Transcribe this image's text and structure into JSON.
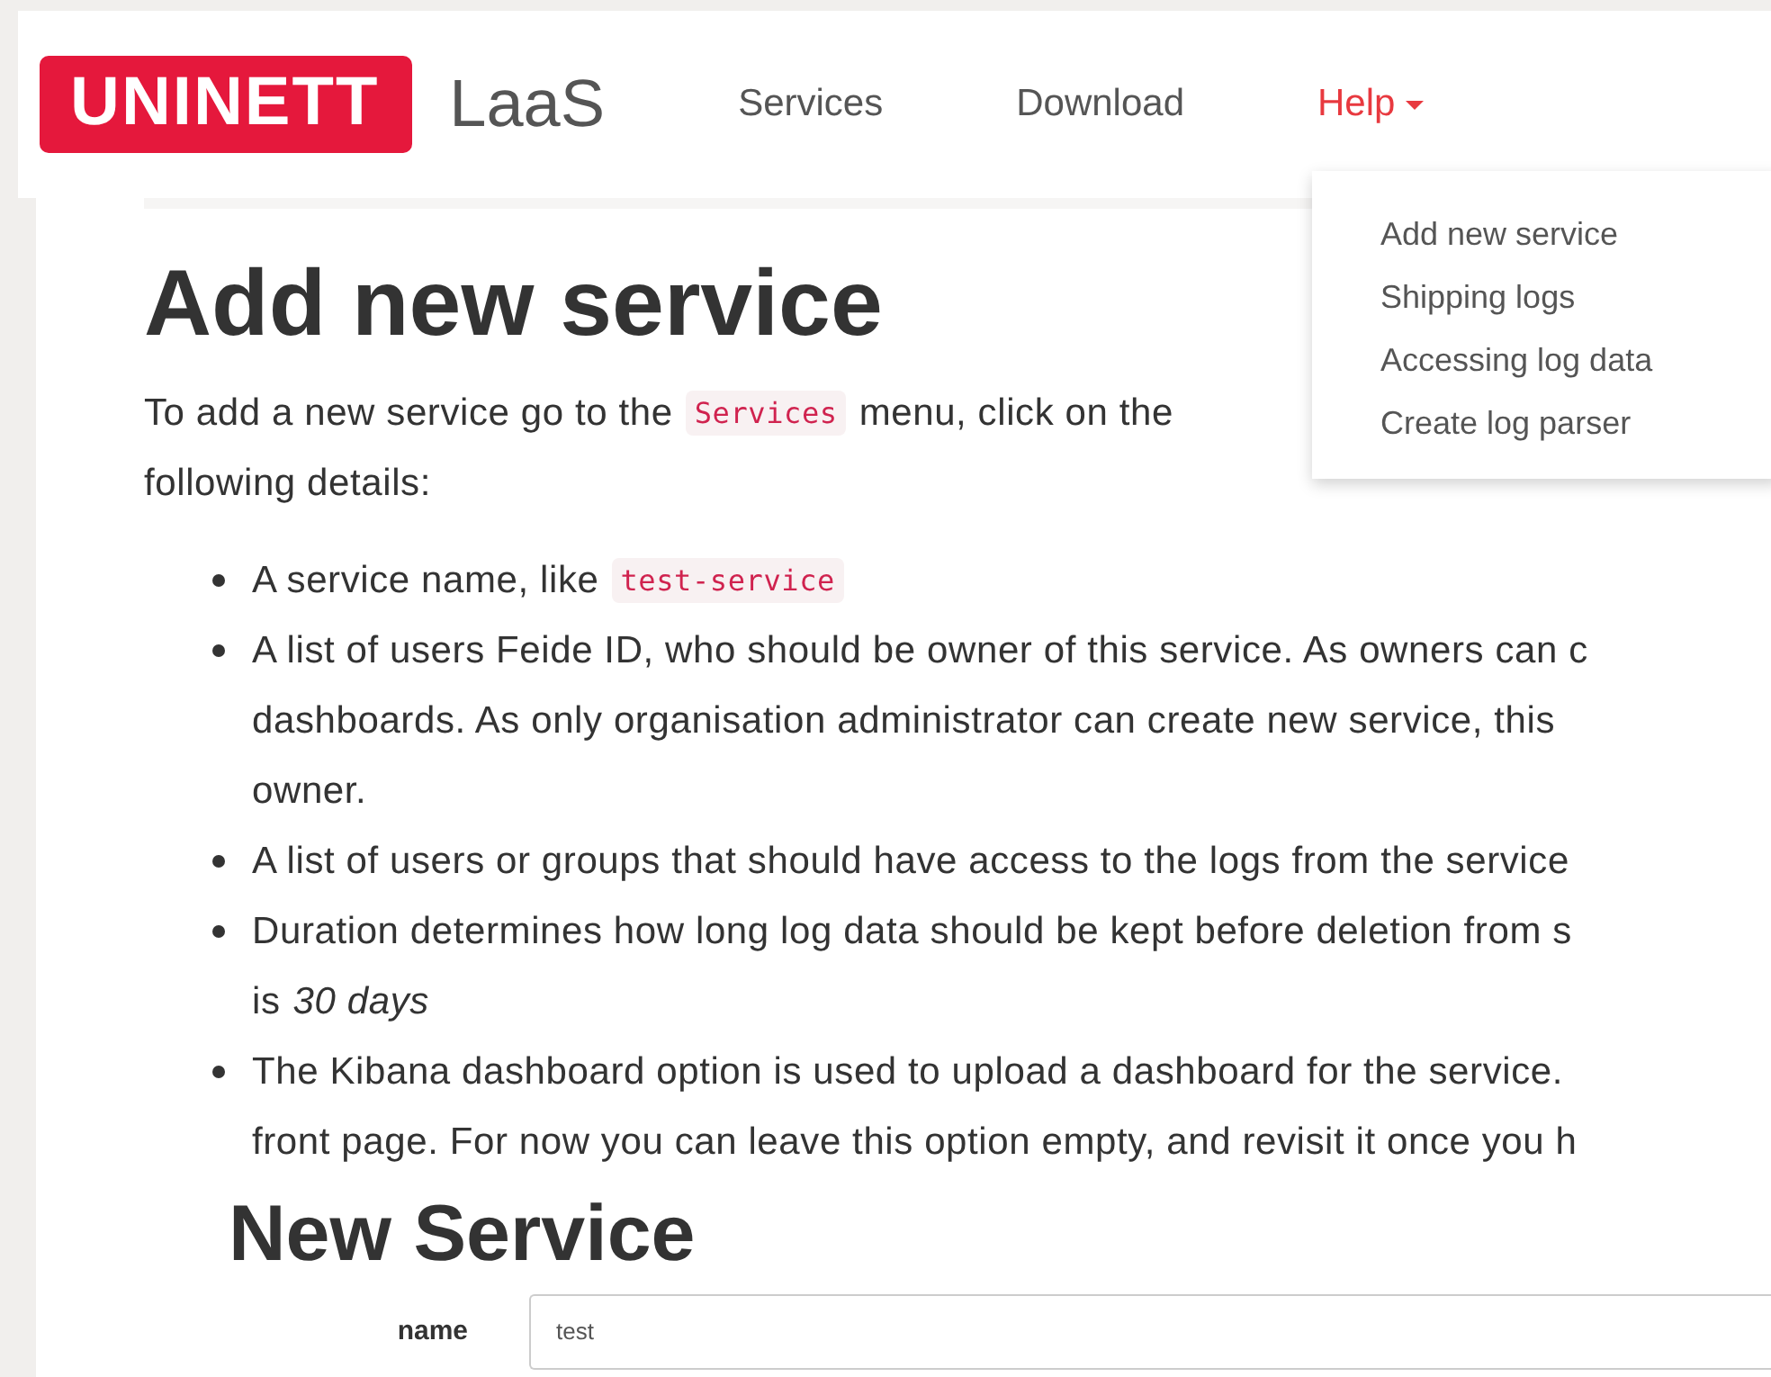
{
  "header": {
    "logo": "UNINETT",
    "product": "LaaS",
    "nav": [
      {
        "label": "Services",
        "selected": false,
        "kind": "link"
      },
      {
        "label": "Download",
        "selected": false,
        "kind": "link"
      },
      {
        "label": "Help",
        "selected": true,
        "kind": "dropdown"
      }
    ]
  },
  "help_menu": {
    "items": [
      {
        "label": "Add new service"
      },
      {
        "label": "Shipping logs"
      },
      {
        "label": "Accessing log data"
      },
      {
        "label": "Create log parser"
      }
    ]
  },
  "page": {
    "title": "Add new service",
    "intro": [
      [
        {
          "kind": "text",
          "text": "To add a new service go to the"
        },
        {
          "kind": "code",
          "text": "Services"
        },
        {
          "kind": "text",
          "text": "menu, click on the"
        }
      ],
      [
        {
          "kind": "text",
          "text": "following details:"
        }
      ]
    ],
    "bullets": [
      {
        "lines": [
          [
            {
              "kind": "text",
              "text": "A service name, like"
            },
            {
              "kind": "code",
              "text": "test-service"
            }
          ]
        ]
      },
      {
        "lines": [
          [
            {
              "kind": "text",
              "text": "A list of users Feide ID, who should be owner of this service. As owners can c"
            }
          ],
          [
            {
              "kind": "text",
              "text": "dashboards. As only organisation administrator can create new service, this"
            }
          ],
          [
            {
              "kind": "text",
              "text": "owner."
            }
          ]
        ]
      },
      {
        "lines": [
          [
            {
              "kind": "text",
              "text": "A list of users or groups that should have access to the logs from the service"
            }
          ]
        ]
      },
      {
        "lines": [
          [
            {
              "kind": "text",
              "text": "Duration determines how long log data should be kept before deletion from s"
            }
          ],
          [
            {
              "kind": "text",
              "text": "is"
            },
            {
              "kind": "italic",
              "text": "30 days"
            }
          ]
        ]
      },
      {
        "lines": [
          [
            {
              "kind": "text",
              "text": "The Kibana dashboard option is used to upload a dashboard for the service."
            }
          ],
          [
            {
              "kind": "text",
              "text": "front page. For now you can leave this option empty, and revisit it once you h"
            }
          ]
        ]
      }
    ],
    "form_title": "New Service",
    "fields": [
      {
        "label": "name",
        "value": "test"
      }
    ]
  }
}
